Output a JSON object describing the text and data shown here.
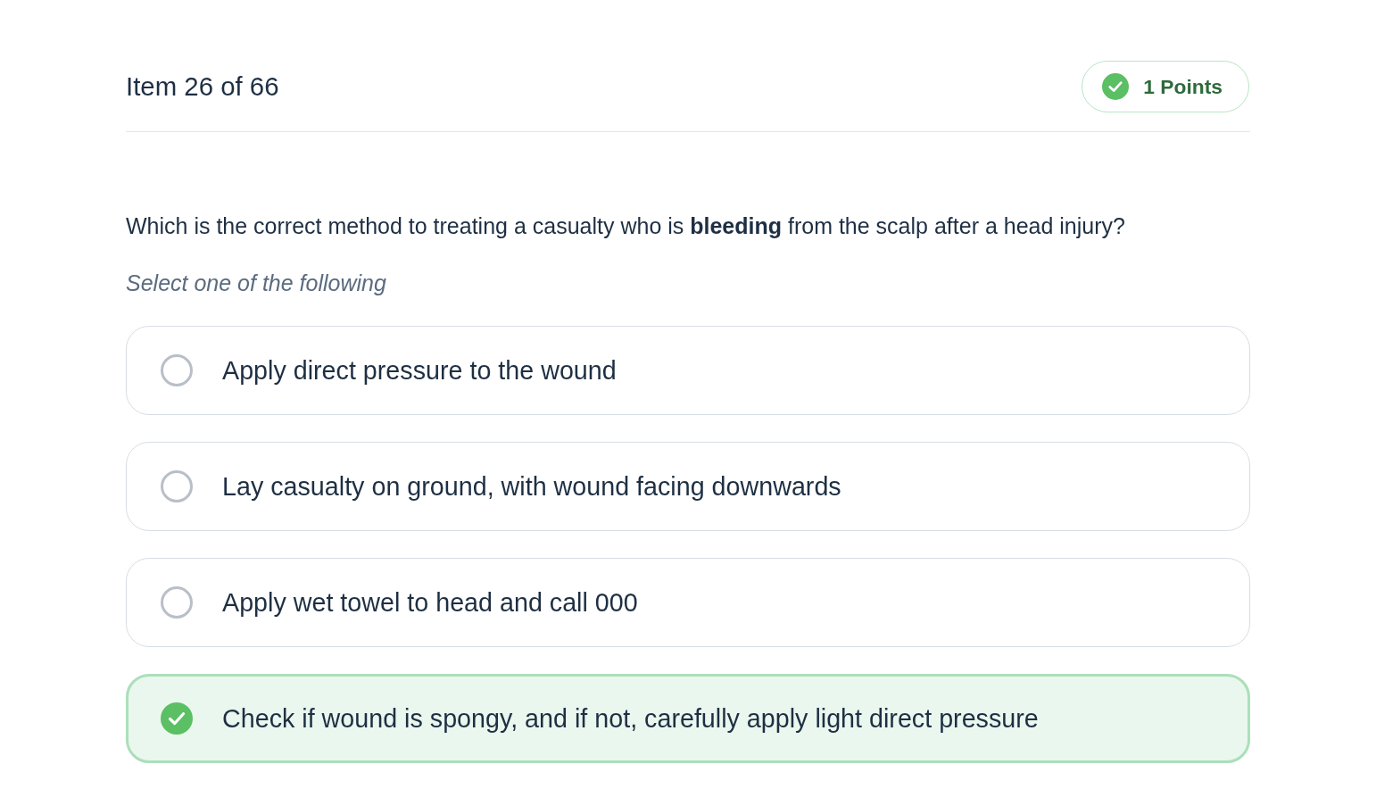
{
  "header": {
    "item_counter": "Item 26 of 66",
    "points_badge": "1 Points"
  },
  "question": {
    "text": "Which is the correct method to treating a casualty who is **bleeding** from the scalp after a head injury?",
    "instruction": "Select one of the following"
  },
  "options": [
    {
      "label": "Apply direct pressure to the wound",
      "selected": false
    },
    {
      "label": "Lay casualty on ground, with wound facing downwards",
      "selected": false
    },
    {
      "label": "Apply wet towel to head and call 000",
      "selected": false
    },
    {
      "label": "Check if wound is spongy, and if not, carefully apply light direct pressure",
      "selected": true
    }
  ]
}
